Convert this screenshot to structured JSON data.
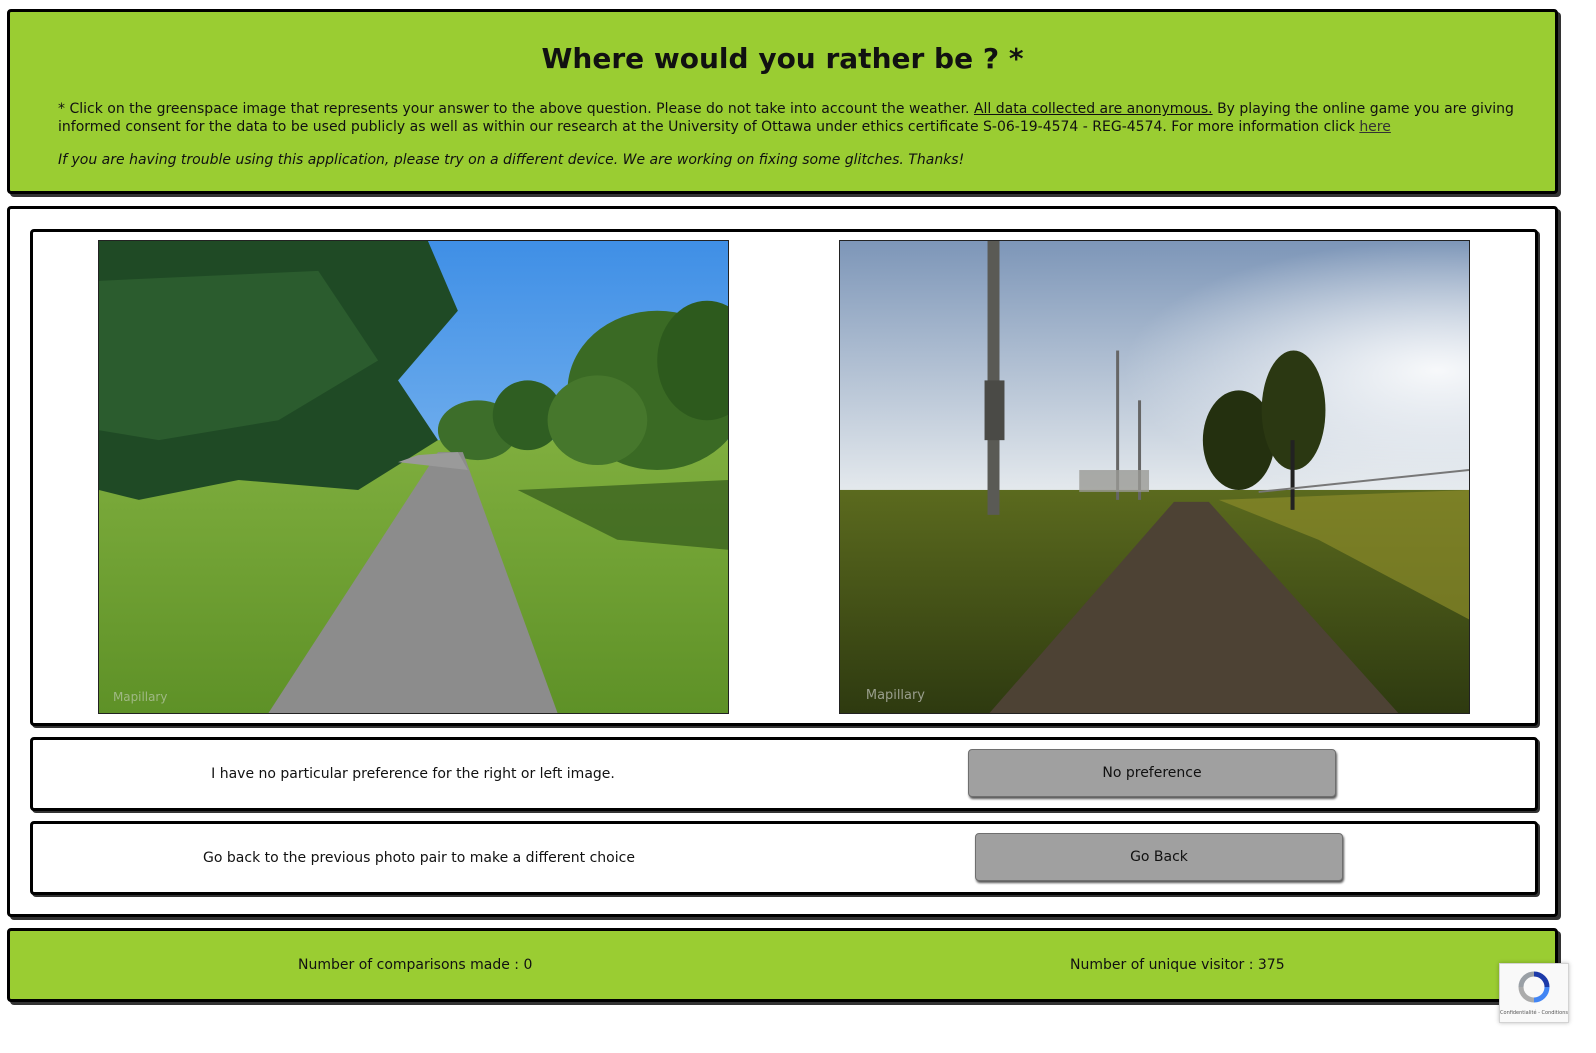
{
  "header": {
    "title": "Where would you rather be ? *",
    "info_prefix": "* Click on the greenspace image that represents your answer to the above question. Please do not take into account the weather.",
    "info_anonymous": "All data collected are anonymous.",
    "info_suffix": "By playing the online game you are giving informed consent for the data to be used publicly as well as within our research at the University of Ottawa under ethics certificate S-06-19-4574 - REG-4574. For more information click",
    "info_link": "here",
    "note": "If you are having trouble using this application, please try on a different device. We are working on fixing some glitches. Thanks!"
  },
  "images": {
    "left_watermark": "Mapillary",
    "right_watermark": "Mapillary"
  },
  "no_preference": {
    "text": "I have no particular preference for the right or left image.",
    "button": "No preference"
  },
  "go_back": {
    "text": "Go back to the previous photo pair to make a different choice",
    "button": "Go Back"
  },
  "footer": {
    "comparisons": "Number of comparisons made : 0",
    "visitors": "Number of unique visitor : 375"
  },
  "recaptcha": {
    "links": "Confidentialité - Conditions"
  },
  "colors": {
    "header_green": "#9acd32",
    "button_gray": "#a0a0a0"
  }
}
